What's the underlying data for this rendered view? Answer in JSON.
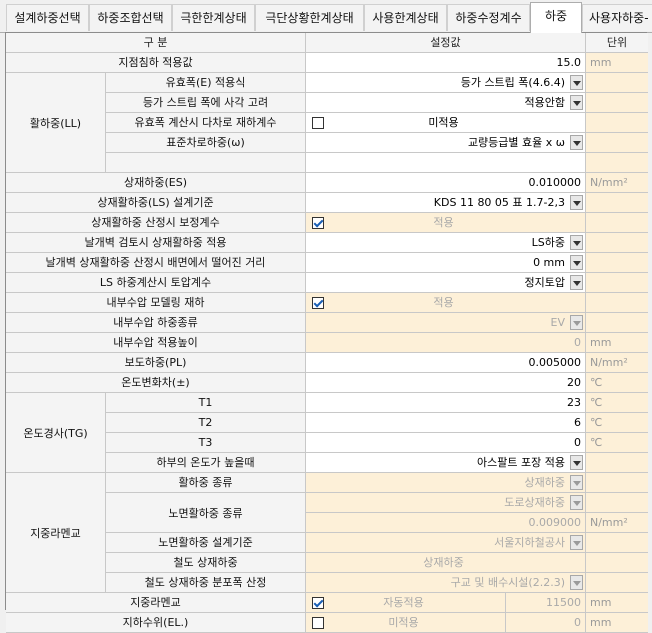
{
  "tabs": [
    "설계하중선택",
    "하중조합선택",
    "극한한계상태",
    "극단상황한계상태",
    "사용한계상태",
    "하중수정계수",
    "하중",
    "사용자하중-"
  ],
  "active_tab": 6,
  "header": {
    "col1": "구 분",
    "col2": "설정값",
    "col3": "단위"
  },
  "groups": {
    "ll": "활하중(LL)",
    "tg": "온도경사(TG)",
    "sub": "지중라멘교"
  },
  "rows": {
    "r0": {
      "label": "지점침하 적용값",
      "value": "15.0",
      "unit": "mm"
    },
    "r1": {
      "label": "유효폭(E) 적용식",
      "value": "등가 스트립 폭(4.6.4)"
    },
    "r2": {
      "label": "등가 스트립 폭에 사각 고려",
      "value": "적용안함"
    },
    "r3": {
      "label": "유효폭 계산시 다차로 재하계수",
      "value": "미적용"
    },
    "r4": {
      "label": "표준차로하중(ω)",
      "value": "교량등급별 효율 x ω"
    },
    "r5": {
      "label": "상재하중(ES)",
      "value": "0.010000",
      "unit": "N/mm²"
    },
    "r6": {
      "label": "상재활하중(LS) 설계기준",
      "value": "KDS 11 80 05 표 1.7-2,3"
    },
    "r7": {
      "label": "상재활하중 산정시 보정계수",
      "value": "적용"
    },
    "r8": {
      "label": "날개벽 검토시 상재활하중 적용",
      "value": "LS하중"
    },
    "r9": {
      "label": "날개벽 상재활하중 산정시 배면에서 떨어진 거리",
      "value": "0 mm"
    },
    "r10": {
      "label": "LS 하중계산시 토압계수",
      "value": "정지토압"
    },
    "r11": {
      "label": "내부수압 모델링 재하",
      "value": "적용"
    },
    "r12": {
      "label": "내부수압 하중종류",
      "value": "EV"
    },
    "r13": {
      "label": "내부수압 적용높이",
      "value": "0",
      "unit": "mm"
    },
    "r14": {
      "label": "보도하중(PL)",
      "value": "0.005000",
      "unit": "N/mm²"
    },
    "r15": {
      "label": "온도변화차(±)",
      "value": "20",
      "unit": "℃"
    },
    "r16": {
      "label": "T1",
      "value": "23",
      "unit": "℃"
    },
    "r17": {
      "label": "T2",
      "value": "6",
      "unit": "℃"
    },
    "r18": {
      "label": "T3",
      "value": "0",
      "unit": "℃"
    },
    "r19": {
      "label": "하부의 온도가 높을때",
      "value": "아스팔트 포장 적용"
    },
    "r20": {
      "label": "활하중 종류",
      "value": "상재하중"
    },
    "r21": {
      "label": "노면활하중 종류",
      "value": "도로상재하중"
    },
    "r22": {
      "value": "0.009000",
      "unit": "N/mm²"
    },
    "r23": {
      "label": "노면활하중 설계기준",
      "value": "서울지하철공사"
    },
    "r24": {
      "label": "철도 상재하중",
      "value": "상재하중"
    },
    "r25": {
      "label": "철도 상재하중 분포폭 산정",
      "value": "구교 및 배수시설(2.2.3)"
    },
    "r26": {
      "label": "지중라멘교",
      "value": "자동적용",
      "value2": "11500",
      "unit": "mm"
    },
    "r27": {
      "label": "지하수위(EL.)",
      "value": "미적용",
      "value2": "0",
      "unit": "mm"
    }
  }
}
